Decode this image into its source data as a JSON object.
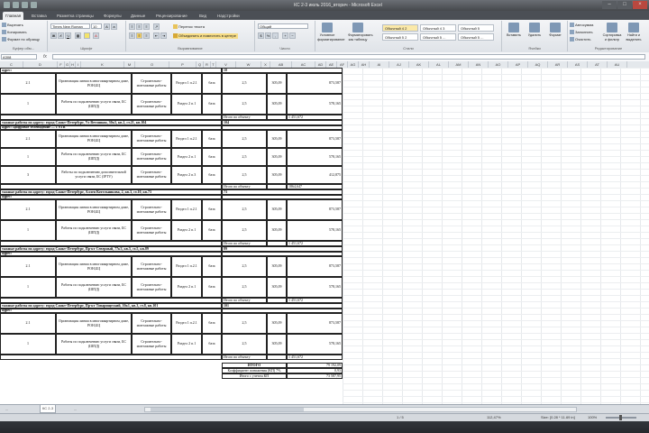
{
  "window": {
    "title": "КС 2-3 июль 2016_вторич - Microsoft Excel"
  },
  "tabs": [
    "Главная",
    "Вставка",
    "Разметка страницы",
    "Формулы",
    "Данные",
    "Рецензирование",
    "Вид",
    "Надстройки"
  ],
  "ribbon": {
    "clipboard": {
      "name": "Буфер обм...",
      "cut": "Вырезать",
      "copy": "Копировать",
      "format_painter": "Формат по образцу"
    },
    "font": {
      "name": "Шрифт",
      "family": "Times New Roman",
      "size": "10"
    },
    "alignment": {
      "name": "Выравнивание",
      "wrap": "Перенос текста",
      "merge": "Объединить и поместить в центре"
    },
    "number": {
      "name": "Число",
      "format": "Общий"
    },
    "styles": {
      "name": "Стили",
      "conditional": "Условное форматирование",
      "as_table": "Форматировать как таблицу",
      "cells": [
        "Обычный 4 2",
        "Обычный 4 3",
        "Обычный 5",
        "Обычный 5 2",
        "Обычный 5 ...",
        "Обычный 5 ..."
      ]
    },
    "cells": {
      "name": "Ячейки",
      "insert": "Вставить",
      "delete": "Удалить",
      "format": "Формат"
    },
    "editing": {
      "name": "Редактирование",
      "autosum": "Автосумма",
      "fill": "Заполнить",
      "clear": "Очистить",
      "sort": "Сортировка и фильтр",
      "find": "Найти и выделить"
    }
  },
  "namebox": "A308",
  "fx": "fx",
  "columns": [
    "C",
    "D",
    "F",
    "G",
    "H",
    "I",
    "K",
    "M",
    "O",
    "P",
    "Q",
    "R",
    "T",
    "V",
    "W",
    "X",
    "AB",
    "AC",
    "AD",
    "AE",
    "AF",
    "AG",
    "AH",
    "AI",
    "AJ",
    "AK",
    "AL",
    "AM",
    "AN",
    "AO",
    "AP",
    "AQ",
    "AR",
    "AS",
    "AT",
    "AU"
  ],
  "sheet": {
    "blocks": [
      {
        "header": "адрес:",
        "num": "10",
        "rows": [
          {
            "a": "2.1",
            "work": "Организация линии в многоквартирном доме, РОН,БЦ",
            "kind": "Строительно-монтажные работы",
            "razdel": "Раздел 1 п.2.1",
            "unit": "база",
            "q": "2,5",
            "price": "305,09",
            "sum": "873,587"
          },
          {
            "a": "1",
            "work": "Работы по подключению услуги связи, БС (ШПД)",
            "kind": "Строительно-монтажные работы",
            "razdel": "Раздел 2 п.1",
            "unit": "база",
            "q": "2,5",
            "price": "305,09",
            "sum": "578,165"
          }
        ],
        "total_label": "Итого по объекту",
        "total": "1 451,672"
      },
      {
        "header": "тажные работы по адресу: город Санкт-Петербург, Ул Ветошная, 30к3, кв.2, ст.21, кв.104",
        "num": "104",
        "sub": "адрес: Цифровое телевидение — 1 STB",
        "rows": [
          {
            "a": "2.1",
            "work": "Организация линии в многоквартирном доме, РОН,БЦ",
            "kind": "Строительно-монтажные работы",
            "razdel": "Раздел 1 п.2.1",
            "unit": "база",
            "q": "2,5",
            "price": "305,09",
            "sum": "873,587"
          },
          {
            "a": "1",
            "work": "Работы по подключению услуги связи, БС (ШПД)",
            "kind": "Строительно-монтажные работы",
            "razdel": "Раздел 2 п.1",
            "unit": "база",
            "q": "2,5",
            "price": "305,09",
            "sum": "578,165"
          },
          {
            "a": "3",
            "work": "Работы по подключению дополнительной услуги связи, БС (IPTV)",
            "kind": "Строительно-монтажные работы",
            "razdel": "Раздел 2 п.3",
            "unit": "база",
            "q": "2,5",
            "price": "305,09",
            "sum": "412,875"
          }
        ],
        "total_label": "Итого по объекту",
        "total": "1864,647"
      },
      {
        "header": "тажные работы по адресу: город Санкт-Петербург, Аллея Котельникова, 2, кв.3, ст.10, кв.73",
        "num": "73",
        "sub": "адрес:",
        "rows": [
          {
            "a": "2.1",
            "work": "Организация линии в многоквартирном доме, РОН,БЦ",
            "kind": "Строительно-монтажные работы",
            "razdel": "Раздел 1 п.2.1",
            "unit": "база",
            "q": "2,5",
            "price": "305,09",
            "sum": "873,587"
          },
          {
            "a": "1",
            "work": "Работы по подключению услуги связи, БС (ШПД)",
            "kind": "Строительно-монтажные работы",
            "razdel": "Раздел 2 п.1",
            "unit": "база",
            "q": "2,5",
            "price": "305,09",
            "sum": "578,165"
          }
        ],
        "total_label": "Итого по объекту",
        "total": "1 451,672"
      },
      {
        "header": "тажные работы по адресу: город Санкт-Петербург, Пр-кт Северный, 77к3, кв.5, ст.5, кв.89",
        "num": "89",
        "sub": "адрес:",
        "rows": [
          {
            "a": "2.1",
            "work": "Организация линии в многоквартирном доме, РОН,БЦ",
            "kind": "Строительно-монтажные работы",
            "razdel": "Раздел 1 п.2.1",
            "unit": "база",
            "q": "2,5",
            "price": "305,09",
            "sum": "873,587"
          },
          {
            "a": "1",
            "work": "Работы по подключению услуги связи, БС (ШПД)",
            "kind": "Строительно-монтажные работы",
            "razdel": "Раздел 2 п.1",
            "unit": "база",
            "q": "2,5",
            "price": "305,09",
            "sum": "578,165"
          }
        ],
        "total_label": "Итого по объекту",
        "total": "1 451,672"
      },
      {
        "header": "тажные работы по адресу: город Санкт-Петербург, Пр-кт Товарищеский, 10к1, кв.3, ст.8, кв.101",
        "num": "101",
        "sub": "адрес:",
        "rows": [
          {
            "a": "2.1",
            "work": "Организация линии в многоквартирном доме, РОН,БЦ",
            "kind": "Строительно-монтажные работы",
            "razdel": "Раздел 1 п.2.1",
            "unit": "база",
            "q": "2,5",
            "price": "305,09",
            "sum": "873,587"
          },
          {
            "a": "1",
            "work": "Работы по подключению услуги связи, БС (ШПД)",
            "kind": "Строительно-монтажные работы",
            "razdel": "Раздел 2 п.1",
            "unit": "база",
            "q": "2,5",
            "price": "305,09",
            "sum": "578,165"
          }
        ],
        "total_label": "Итого по объекту",
        "total": "1 451,672"
      }
    ],
    "summary": [
      {
        "label": "ИТОГО",
        "value": "79 192,09"
      },
      {
        "label": "Коэффициент понижения (КП) 7%",
        "value": "0,93"
      },
      {
        "label": "Итого с учетом КП",
        "value": "73 587,95"
      }
    ]
  },
  "sheettabs": [
    "...",
    "КС 2-3",
    "..."
  ],
  "status": {
    "page": "1 / 5",
    "zoom": "112,47%",
    "size": "Size: [0.28 * 11.69 in]",
    "zoom_pct": "100%"
  }
}
